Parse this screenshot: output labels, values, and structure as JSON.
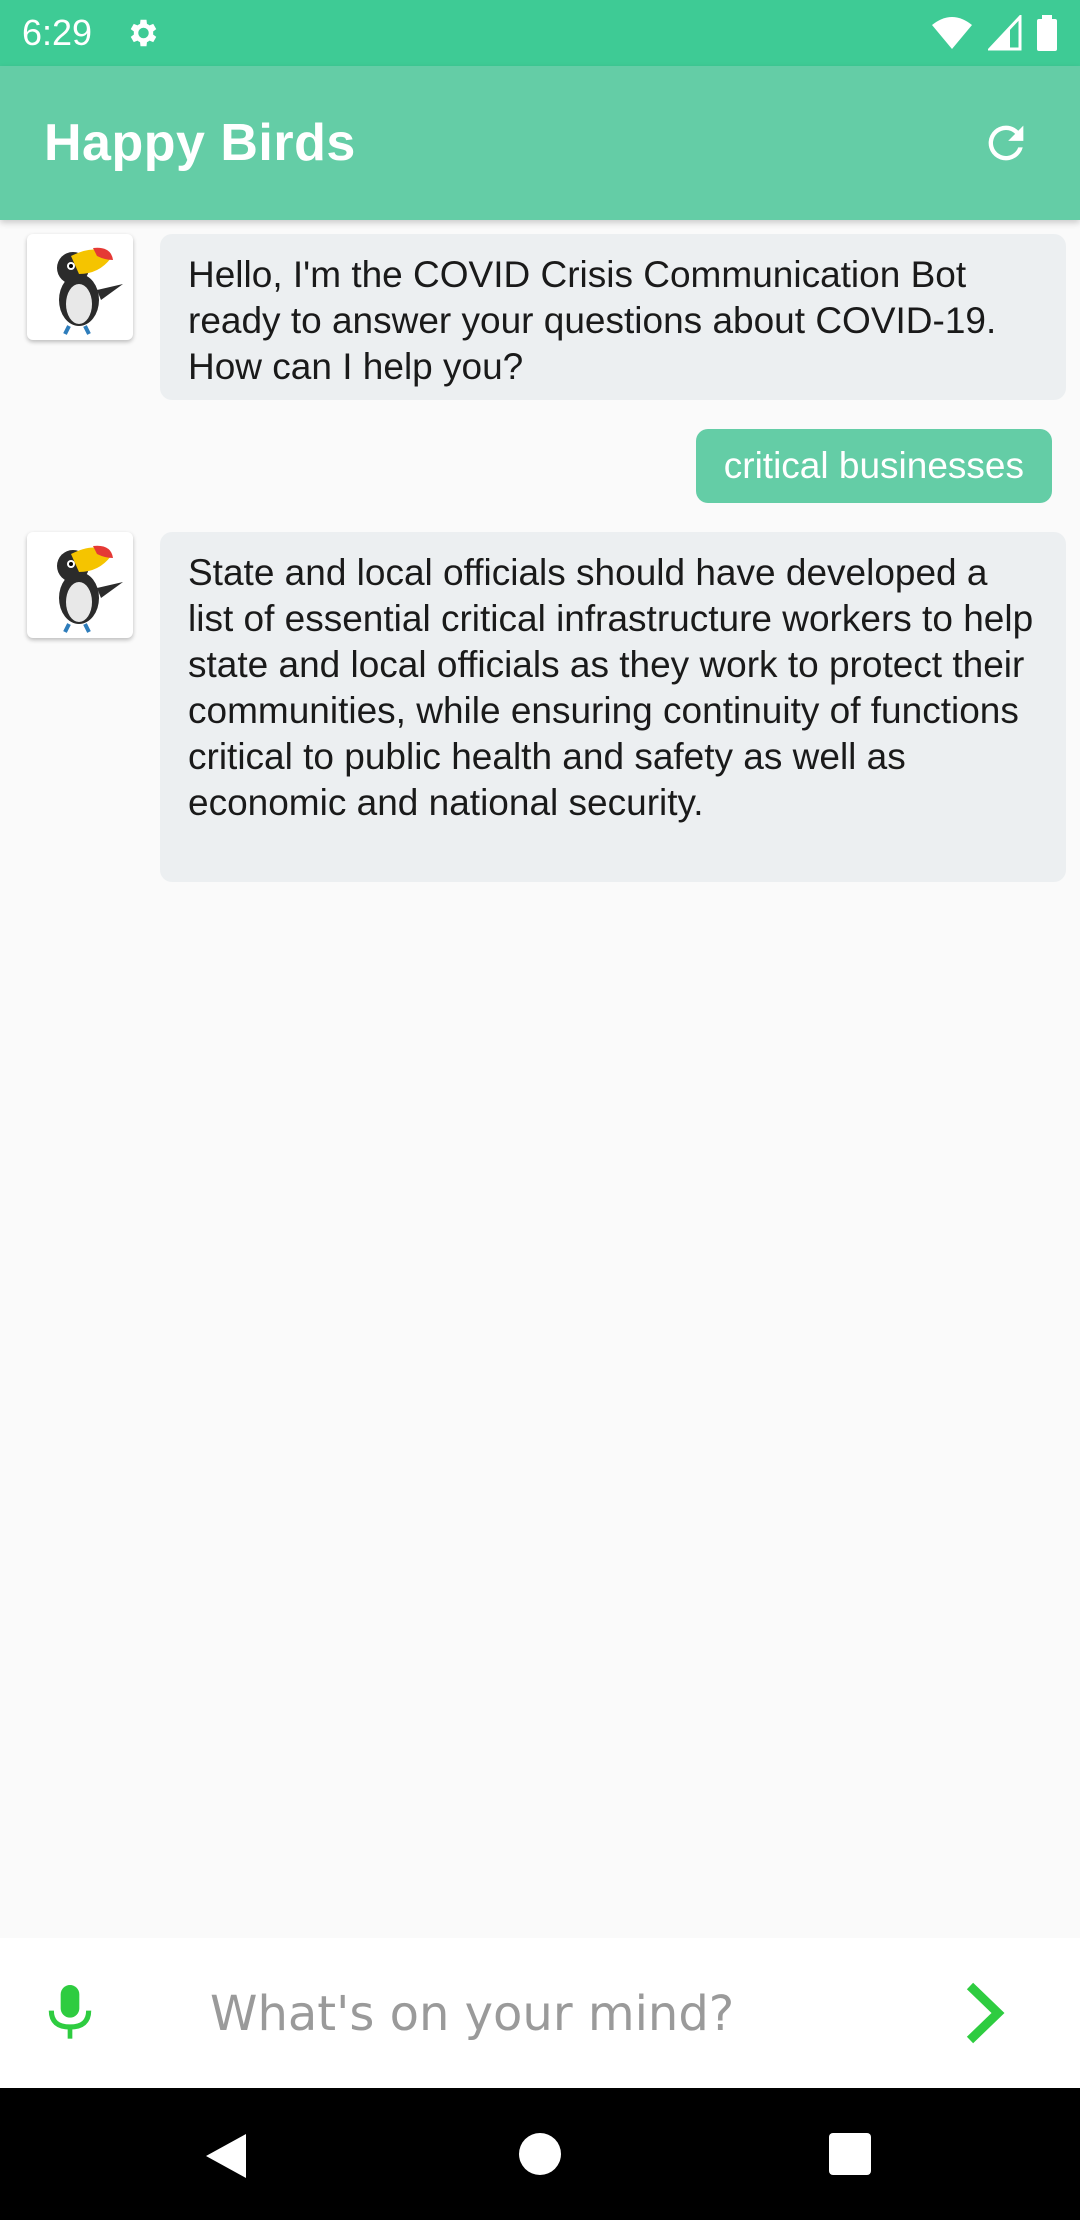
{
  "status_bar": {
    "time": "6:29"
  },
  "app_bar": {
    "title": "Happy Birds",
    "refresh_icon": "refresh-icon"
  },
  "messages": [
    {
      "sender": "bot",
      "text": "Hello, I'm the COVID Crisis Communication Bot ready to answer your questions about COVID-19. How can I help you?"
    },
    {
      "sender": "user",
      "text": "critical businesses"
    },
    {
      "sender": "bot",
      "text": "State and local officials should have developed a list of essential critical infrastructure workers to help state and local officials as they work to protect their communities, while ensuring continuity of functions critical to public health and safety as well as economic and national security."
    }
  ],
  "input": {
    "placeholder": "What's on your mind?",
    "value": ""
  },
  "colors": {
    "status_bar": "#3ecb95",
    "app_bar": "#64cda6",
    "user_bubble": "#64cda6",
    "bot_bubble": "#eceff1",
    "accent_green": "#2ecc40"
  }
}
